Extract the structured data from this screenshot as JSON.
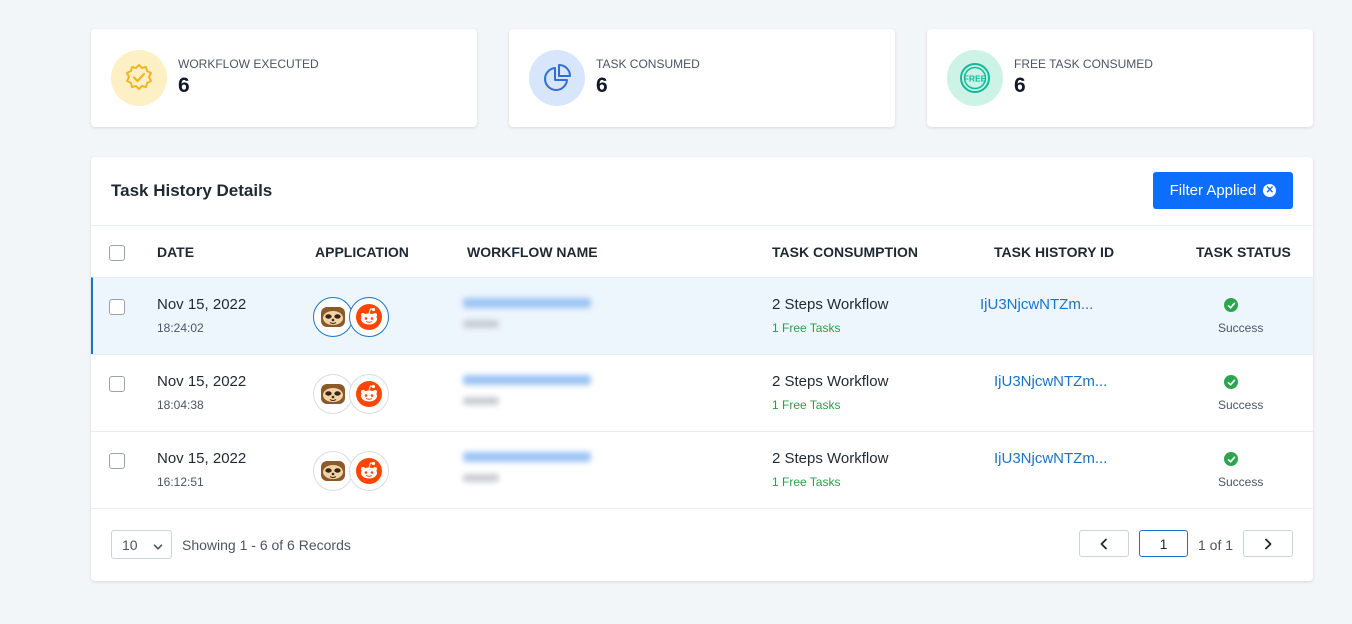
{
  "stats": [
    {
      "label": "WORKFLOW EXECUTED",
      "value": "6",
      "icon": "badge-check-icon",
      "bg": "#fdf0c4",
      "color": "#f0b429"
    },
    {
      "label": "TASK CONSUMED",
      "value": "6",
      "icon": "pie-chart-icon",
      "bg": "#d7e6fb",
      "color": "#2f6fd6"
    },
    {
      "label": "FREE TASK CONSUMED",
      "value": "6",
      "icon": "free-icon",
      "bg": "#ccf3e6",
      "color": "#11b99a"
    }
  ],
  "panel": {
    "title": "Task History Details",
    "filter_label": "Filter Applied"
  },
  "table": {
    "headers": {
      "date": "DATE",
      "application": "APPLICATION",
      "workflow": "WORKFLOW NAME",
      "consumption": "TASK CONSUMPTION",
      "history_id": "TASK HISTORY ID",
      "status": "TASK STATUS"
    },
    "rows": [
      {
        "date": "Nov 15, 2022",
        "time": "18:24:02",
        "consumption": "2 Steps Workflow",
        "free": "1 Free Tasks",
        "history_id": "IjU3NjcwNTZm...",
        "status": "Success"
      },
      {
        "date": "Nov 15, 2022",
        "time": "18:04:38",
        "consumption": "2 Steps Workflow",
        "free": "1 Free Tasks",
        "history_id": "IjU3NjcwNTZm...",
        "status": "Success"
      },
      {
        "date": "Nov 15, 2022",
        "time": "16:12:51",
        "consumption": "2 Steps Workflow",
        "free": "1 Free Tasks",
        "history_id": "IjU3NjcwNTZm...",
        "status": "Success"
      }
    ]
  },
  "footer": {
    "page_size": "10",
    "showing": "Showing 1 - 6 of 6 Records",
    "current_page": "1",
    "of_pages": "1 of 1"
  },
  "colors": {
    "accent": "#0d6efd",
    "link": "#1a73c8",
    "success": "#2ea44f",
    "free_text": "#2e9b48"
  }
}
